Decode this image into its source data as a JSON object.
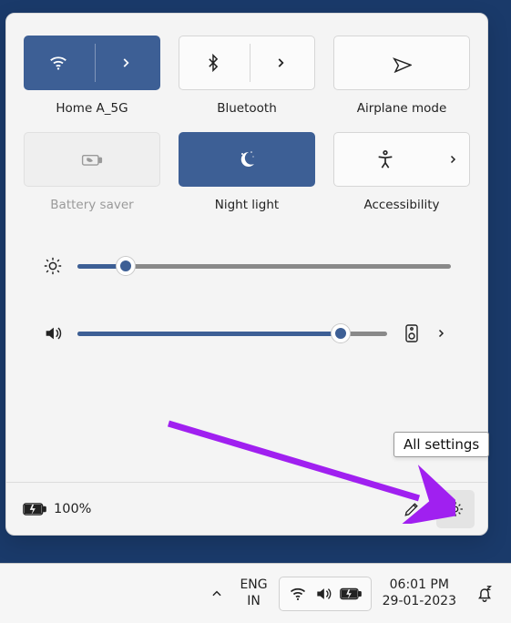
{
  "tiles": {
    "wifi": {
      "label": "Home A_5G",
      "on": true,
      "has_more": true
    },
    "bluetooth": {
      "label": "Bluetooth",
      "on": false,
      "has_more": true
    },
    "airplane": {
      "label": "Airplane mode",
      "on": false,
      "has_more": false
    },
    "battery": {
      "label": "Battery saver",
      "on": false,
      "disabled": true
    },
    "nightlight": {
      "label": "Night light",
      "on": true,
      "has_more": false
    },
    "accessibility": {
      "label": "Accessibility",
      "on": false,
      "has_more": true
    }
  },
  "sliders": {
    "brightness": {
      "percent": 13
    },
    "volume": {
      "percent": 85
    }
  },
  "panel_footer": {
    "battery_percent": "100%"
  },
  "tooltip": {
    "all_settings": "All settings"
  },
  "taskbar": {
    "lang_top": "ENG",
    "lang_bottom": "IN",
    "time": "06:01 PM",
    "date": "29-01-2023"
  },
  "colors": {
    "accent": "#3d5f95",
    "annotation": "#a020f0"
  }
}
